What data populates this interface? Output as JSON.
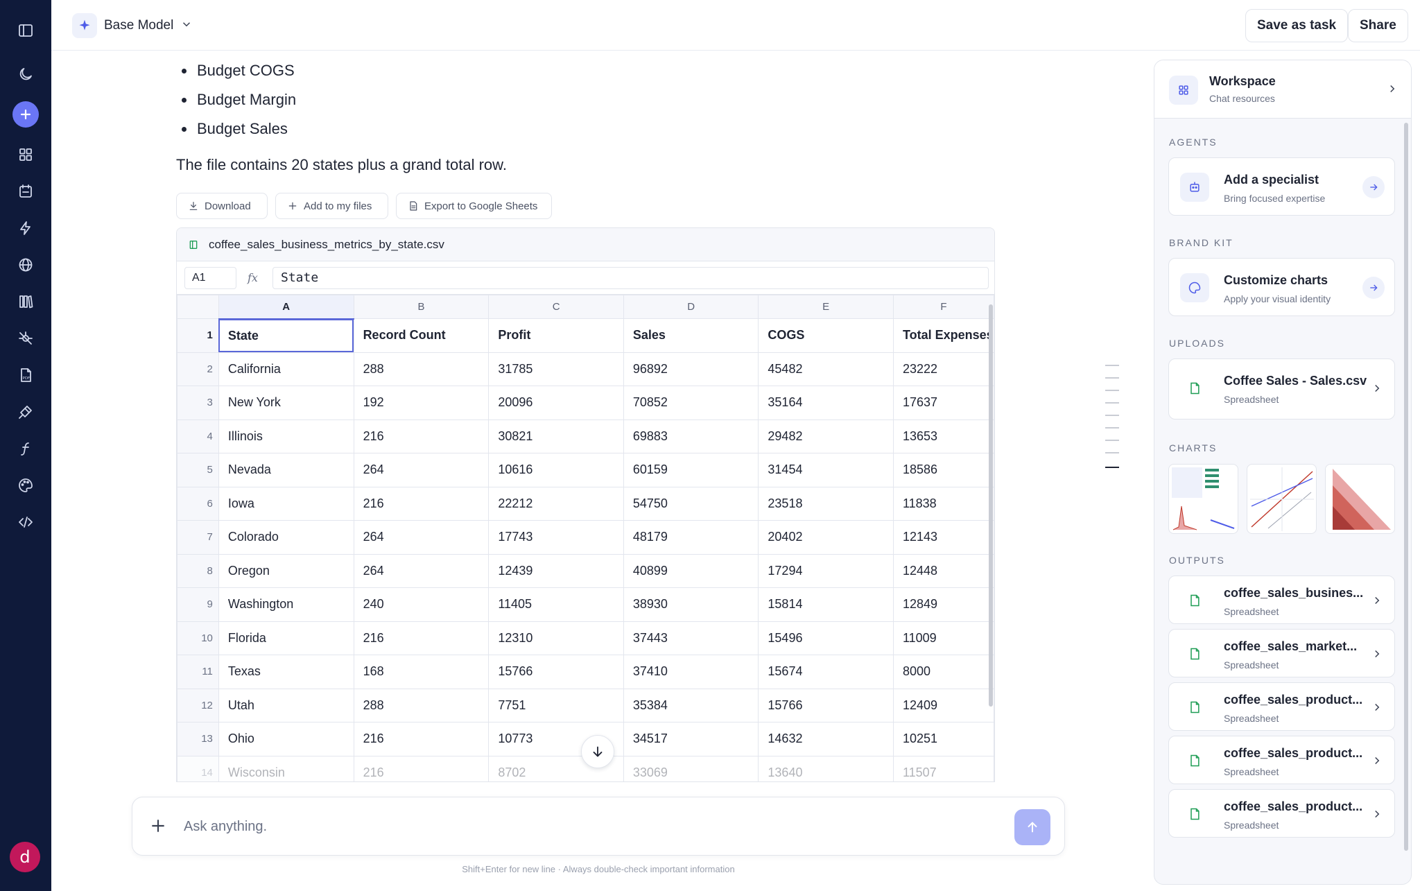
{
  "topbar": {
    "model_label": "Base Model",
    "save_task_label": "Save as task",
    "share_label": "Share"
  },
  "message": {
    "bullets": [
      "Budget COGS",
      "Budget Margin",
      "Budget Sales"
    ],
    "summary": "The file contains 20 states plus a grand total row.",
    "actions": {
      "download": "Download",
      "add_files": "Add to my files",
      "export_sheets": "Export to Google Sheets"
    }
  },
  "sheet": {
    "filename": "coffee_sales_business_metrics_by_state.csv",
    "cell_ref": "A1",
    "fx_label": "fx",
    "formula_value": "State",
    "columns": [
      "A",
      "B",
      "C",
      "D",
      "E",
      "F"
    ],
    "rows": [
      {
        "n": "1",
        "cells": [
          "State",
          "Record Count",
          "Profit",
          "Sales",
          "COGS",
          "Total Expenses"
        ]
      },
      {
        "n": "2",
        "cells": [
          "California",
          "288",
          "31785",
          "96892",
          "45482",
          "23222"
        ]
      },
      {
        "n": "3",
        "cells": [
          "New York",
          "192",
          "20096",
          "70852",
          "35164",
          "17637"
        ]
      },
      {
        "n": "4",
        "cells": [
          "Illinois",
          "216",
          "30821",
          "69883",
          "29482",
          "13653"
        ]
      },
      {
        "n": "5",
        "cells": [
          "Nevada",
          "264",
          "10616",
          "60159",
          "31454",
          "18586"
        ]
      },
      {
        "n": "6",
        "cells": [
          "Iowa",
          "216",
          "22212",
          "54750",
          "23518",
          "11838"
        ]
      },
      {
        "n": "7",
        "cells": [
          "Colorado",
          "264",
          "17743",
          "48179",
          "20402",
          "12143"
        ]
      },
      {
        "n": "8",
        "cells": [
          "Oregon",
          "264",
          "12439",
          "40899",
          "17294",
          "12448"
        ]
      },
      {
        "n": "9",
        "cells": [
          "Washington",
          "240",
          "11405",
          "38930",
          "15814",
          "12849"
        ]
      },
      {
        "n": "10",
        "cells": [
          "Florida",
          "216",
          "12310",
          "37443",
          "15496",
          "11009"
        ]
      },
      {
        "n": "11",
        "cells": [
          "Texas",
          "168",
          "15766",
          "37410",
          "15674",
          "8000"
        ]
      },
      {
        "n": "12",
        "cells": [
          "Utah",
          "288",
          "7751",
          "35384",
          "15766",
          "12409"
        ]
      },
      {
        "n": "13",
        "cells": [
          "Ohio",
          "216",
          "10773",
          "34517",
          "14632",
          "10251"
        ]
      },
      {
        "n": "14",
        "cells": [
          "Wisconsin",
          "216",
          "8702",
          "33069",
          "13640",
          "11507"
        ]
      }
    ]
  },
  "composer": {
    "placeholder": "Ask anything.",
    "hint": "Shift+Enter for new line · Always double-check important information"
  },
  "panel": {
    "workspace_title": "Workspace",
    "workspace_sub": "Chat resources",
    "sections": {
      "agents": "AGENTS",
      "brand_kit": "BRAND KIT",
      "uploads": "UPLOADS",
      "charts": "CHARTS",
      "outputs": "OUTPUTS"
    },
    "agent_card": {
      "title": "Add a specialist",
      "sub": "Bring focused expertise"
    },
    "brand_card": {
      "title": "Customize charts",
      "sub": "Apply your visual identity"
    },
    "upload_card": {
      "title": "Coffee Sales - Sales.csv",
      "sub": "Spreadsheet"
    },
    "outputs": [
      {
        "title": "coffee_sales_busines...",
        "sub": "Spreadsheet",
        "type": "CSV"
      },
      {
        "title": "coffee_sales_market...",
        "sub": "Spreadsheet",
        "type": "CSV"
      },
      {
        "title": "coffee_sales_product...",
        "sub": "Spreadsheet",
        "type": "CSV"
      },
      {
        "title": "coffee_sales_product...",
        "sub": "Spreadsheet",
        "type": "XLS"
      },
      {
        "title": "coffee_sales_product...",
        "sub": "Spreadsheet",
        "type": "XLS"
      }
    ]
  },
  "user": {
    "avatar_initial": "d"
  },
  "colors": {
    "rail": "#0f1a3a",
    "accent": "#5a67d8",
    "send": "#aab3f7",
    "avatar": "#c2185b"
  }
}
